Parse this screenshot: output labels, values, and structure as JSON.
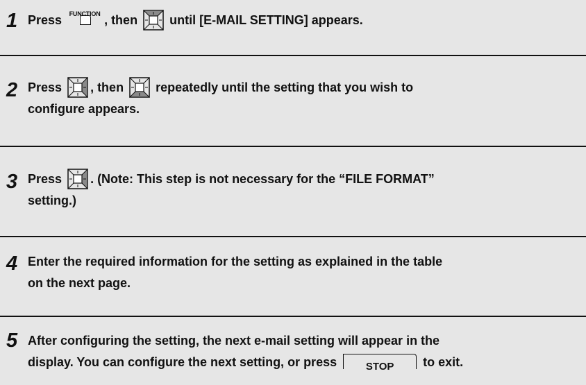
{
  "steps": [
    {
      "number": "1",
      "parts": {
        "press": "Press",
        "function_label": "FUNCTION",
        "then": ", then",
        "tail": "until [E-MAIL SETTING] appears."
      }
    },
    {
      "number": "2",
      "parts": {
        "press": "Press",
        "then": ", then",
        "tail": "repeatedly until the setting that you wish to",
        "line2": "configure appears."
      }
    },
    {
      "number": "3",
      "parts": {
        "press": "Press",
        "tail": ". (Note: This step is not necessary for the “FILE FORMAT”",
        "line2": "setting.)"
      }
    },
    {
      "number": "4",
      "parts": {
        "line1": "Enter the required information for the setting as explained in the table",
        "line2": "on the next page."
      }
    },
    {
      "number": "5",
      "parts": {
        "line1": "After configuring the setting, the next e-mail setting will appear in the",
        "line2": "display. You can configure the next setting, or press",
        "stop_label": "STOP",
        "tail": "to exit."
      }
    }
  ],
  "icons": {
    "function_key": "function-key-icon",
    "nav_up_key": "nav-up-key-icon",
    "nav_down_key": "nav-down-key-icon",
    "nav_right_key": "nav-right-key-icon",
    "stop_key": "stop-key-icon"
  }
}
